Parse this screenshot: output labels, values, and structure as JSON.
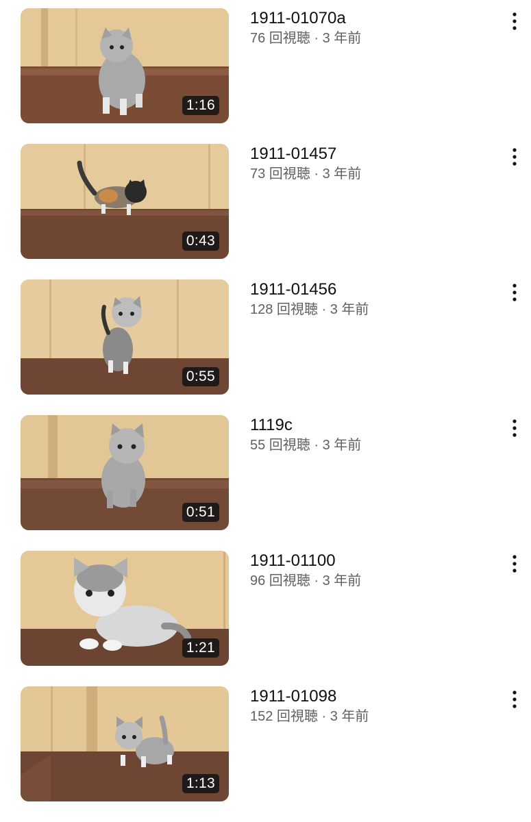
{
  "colors": {
    "title": "#0f0f0f",
    "secondary": "#606060",
    "duration_bg": "#141414"
  },
  "icons": {
    "more": "more-vert-icon"
  },
  "videos": [
    {
      "title": "1911-01070a",
      "views": "76 回視聴",
      "sep": "·",
      "age": "3 年前",
      "duration": "1:16"
    },
    {
      "title": "1911-01457",
      "views": "73 回視聴",
      "sep": "·",
      "age": "3 年前",
      "duration": "0:43"
    },
    {
      "title": "1911-01456",
      "views": "128 回視聴",
      "sep": "·",
      "age": "3 年前",
      "duration": "0:55"
    },
    {
      "title": "1119c",
      "views": "55 回視聴",
      "sep": "·",
      "age": "3 年前",
      "duration": "0:51"
    },
    {
      "title": "1911-01100",
      "views": "96 回視聴",
      "sep": "·",
      "age": "3 年前",
      "duration": "1:21"
    },
    {
      "title": "1911-01098",
      "views": "152 回視聴",
      "sep": "·",
      "age": "3 年前",
      "duration": "1:13"
    }
  ]
}
